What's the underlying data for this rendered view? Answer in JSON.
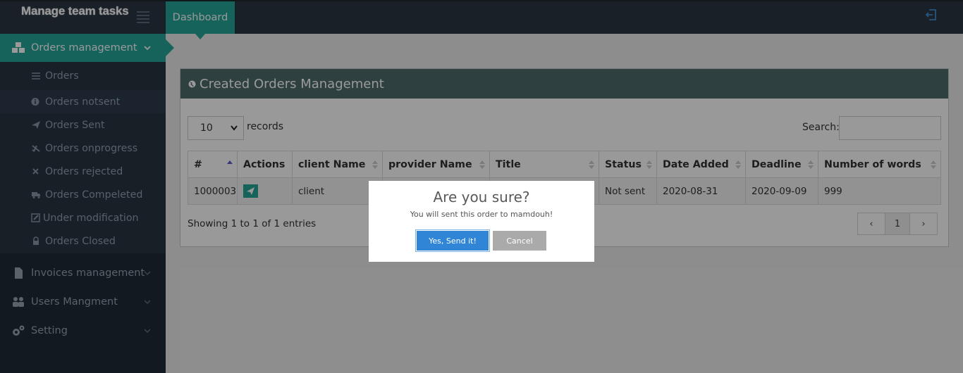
{
  "header": {
    "brand": "Manage team tasks",
    "active_tab": "Dashboard"
  },
  "sidebar": {
    "menus": [
      {
        "label": "Orders management",
        "icon": "cubes-icon",
        "active": true
      },
      {
        "label": "Invoices management",
        "icon": "file-icon",
        "active": false
      },
      {
        "label": "Users Mangment",
        "icon": "users-icon",
        "active": false
      },
      {
        "label": "Setting",
        "icon": "gears-icon",
        "active": false
      }
    ],
    "orders_submenu": [
      {
        "label": "Orders",
        "icon": "list-icon"
      },
      {
        "label": "Orders notsent",
        "icon": "info-icon"
      },
      {
        "label": "Orders Sent",
        "icon": "paper-plane-icon"
      },
      {
        "label": "Orders onprogress",
        "icon": "plane-icon"
      },
      {
        "label": "Orders rejected",
        "icon": "times-icon"
      },
      {
        "label": "Orders Compeleted",
        "icon": "truck-icon"
      },
      {
        "label": "Under modification",
        "icon": "edit-icon"
      },
      {
        "label": "Orders Closed",
        "icon": "lock-icon"
      }
    ]
  },
  "portlet": {
    "title": "Created Orders Management",
    "page_length": "10",
    "records_label": "records",
    "search_label": "Search:",
    "columns": [
      "#",
      "Actions",
      "client Name",
      "provider Name",
      "Title",
      "Status",
      "Date Added",
      "Deadline",
      "Number of words"
    ],
    "rows": [
      {
        "id": "1000003",
        "client": "client",
        "provider": "",
        "title": "",
        "status": "Not sent",
        "date_added": "2020-08-31",
        "deadline": "2020-09-09",
        "words": "999"
      }
    ],
    "info": "Showing 1 to 1 of 1 entries",
    "pagination": {
      "prev": "‹",
      "current": "1",
      "next": "›"
    }
  },
  "dialog": {
    "title": "Are you sure?",
    "text": "You will sent this order to mamdouh!",
    "confirm": "Yes, Send it!",
    "cancel": "Cancel"
  },
  "colors": {
    "accent": "#26a69a",
    "topbar": "#2b3643",
    "sidebar": "#1e2a36",
    "confirm": "#3085d6"
  }
}
